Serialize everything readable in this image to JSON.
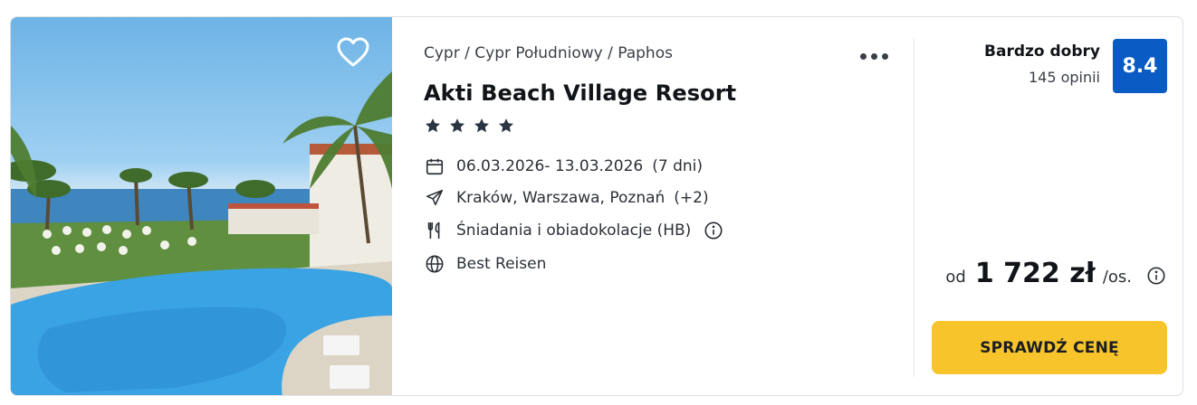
{
  "offer": {
    "breadcrumb": [
      "Cypr",
      "Cypr Południowy",
      "Paphos"
    ],
    "breadcrumb_separator": "/",
    "hotel_name": "Akti Beach Village Resort",
    "stars": 4,
    "dates": "06.03.2026- 13.03.2026",
    "duration": "(7 dni)",
    "departures": "Kraków, Warszawa, Poznań",
    "departures_extra": "(+2)",
    "board": "Śniadania i obiadokolacje (HB)",
    "operator": "Best Reisen",
    "rating_label": "Bardzo dobry",
    "rating_count": "145 opinii",
    "rating_score": "8.4",
    "price_prefix": "od",
    "price_amount": "1 722 zł",
    "price_suffix": "/os.",
    "cta_label": "SPRAWDŹ CENĘ"
  },
  "icons": {
    "favorite": "heart-outline-icon",
    "more": "more-horizontal-icon",
    "star": "star-icon",
    "dates": "calendar-icon",
    "departures": "plane-icon",
    "board": "cutlery-icon",
    "operator": "globe-icon",
    "info": "info-circle-icon"
  },
  "colors": {
    "rating_badge": "#0a5bc4",
    "cta_background": "#f7c52b",
    "star": "#2b3443"
  }
}
